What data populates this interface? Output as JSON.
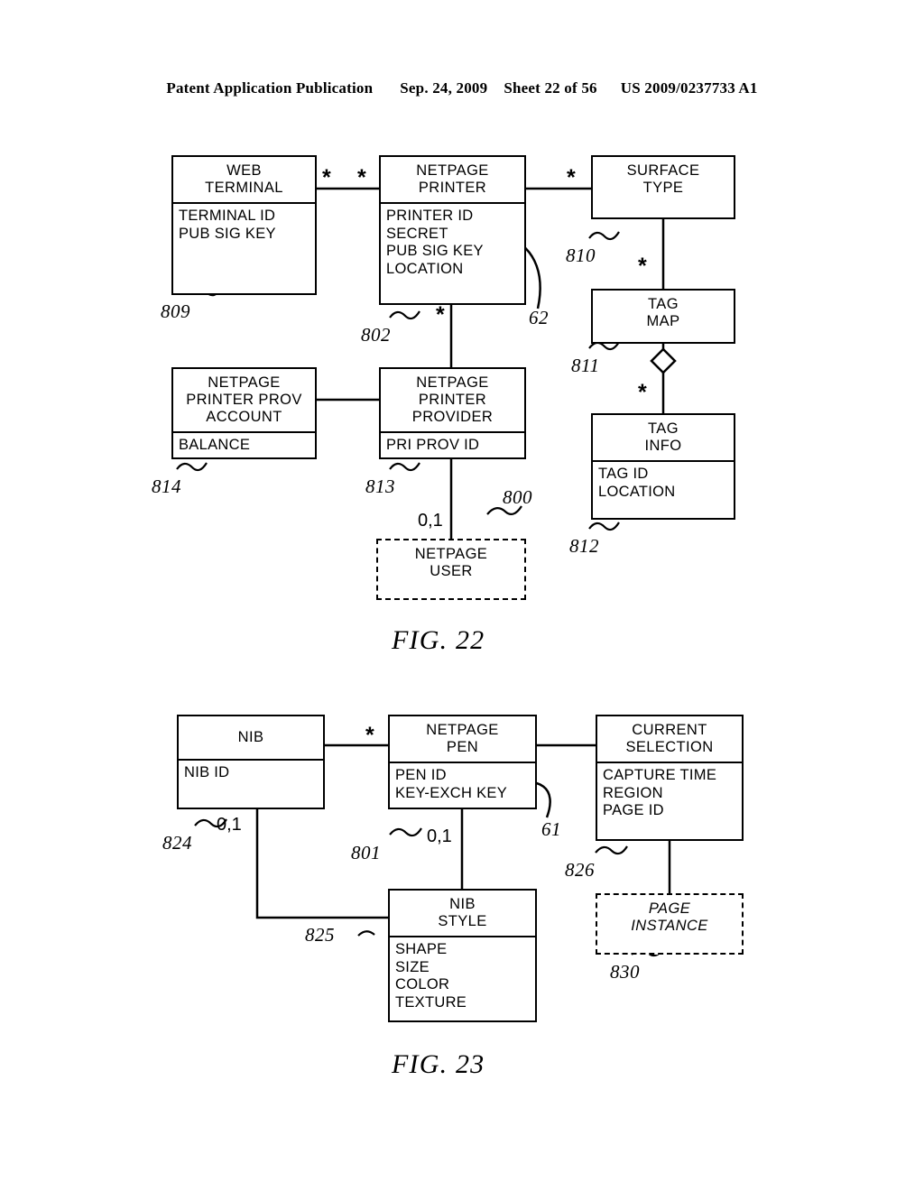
{
  "header": {
    "publication": "Patent Application Publication",
    "date": "Sep. 24, 2009",
    "sheet": "Sheet 22 of 56",
    "docnum": "US 2009/0237733 A1"
  },
  "fig22": {
    "caption": "FIG. 22",
    "entities": {
      "web_terminal": {
        "title": "WEB\nTERMINAL",
        "attrs": "TERMINAL ID\nPUB SIG KEY",
        "ref": "809"
      },
      "netpage_printer": {
        "title": "NETPAGE\nPRINTER",
        "attrs": "PRINTER ID\nSECRET\nPUB SIG KEY\nLOCATION",
        "ref": "802"
      },
      "surface_type": {
        "title": "SURFACE\nTYPE",
        "attrs": "",
        "ref": "810"
      },
      "tag_map": {
        "title": "TAG\nMAP",
        "attrs": "",
        "ref": "811"
      },
      "tag_info": {
        "title": "TAG\nINFO",
        "attrs": "TAG ID\nLOCATION",
        "ref": "812"
      },
      "netpage_printer_prov_account": {
        "title": "NETPAGE\nPRINTER PROV\nACCOUNT",
        "attrs": "BALANCE",
        "ref": "814"
      },
      "netpage_printer_provider": {
        "title": "NETPAGE\nPRINTER\nPROVIDER",
        "attrs": "PRI PROV ID",
        "ref": "813"
      },
      "netpage_user": {
        "title": "NETPAGE\nUSER",
        "attrs": "",
        "ref": "800"
      }
    },
    "cardinalities": {
      "printer_left_star": "*",
      "terminal_right_star": "*",
      "printer_surface_star": "*",
      "surface_tagmap_star": "*",
      "tagmap_taginfo_star": "*",
      "printer_provider_star": "*",
      "user_zero_one": "0,1"
    },
    "refs_extra": {
      "ref62": "62"
    }
  },
  "fig23": {
    "caption": "FIG. 23",
    "entities": {
      "nib": {
        "title": "NIB",
        "attrs": "NIB ID",
        "ref": "824"
      },
      "netpage_pen": {
        "title": "NETPAGE\nPEN",
        "attrs": "PEN ID\nKEY-EXCH KEY",
        "ref": "801"
      },
      "current_selection": {
        "title": "CURRENT\nSELECTION",
        "attrs": "CAPTURE TIME\nREGION\nPAGE ID",
        "ref": "826"
      },
      "nib_style": {
        "title": "NIB\nSTYLE",
        "attrs": "SHAPE\nSIZE\nCOLOR\nTEXTURE",
        "ref": "825"
      },
      "page_instance": {
        "title": "PAGE\nINSTANCE",
        "attrs": "",
        "ref": "830"
      }
    },
    "cardinalities": {
      "nib_pen_star": "*",
      "nib_zero_one": "0,1",
      "pen_style_zero_one": "0,1"
    },
    "refs_extra": {
      "ref61": "61"
    }
  }
}
